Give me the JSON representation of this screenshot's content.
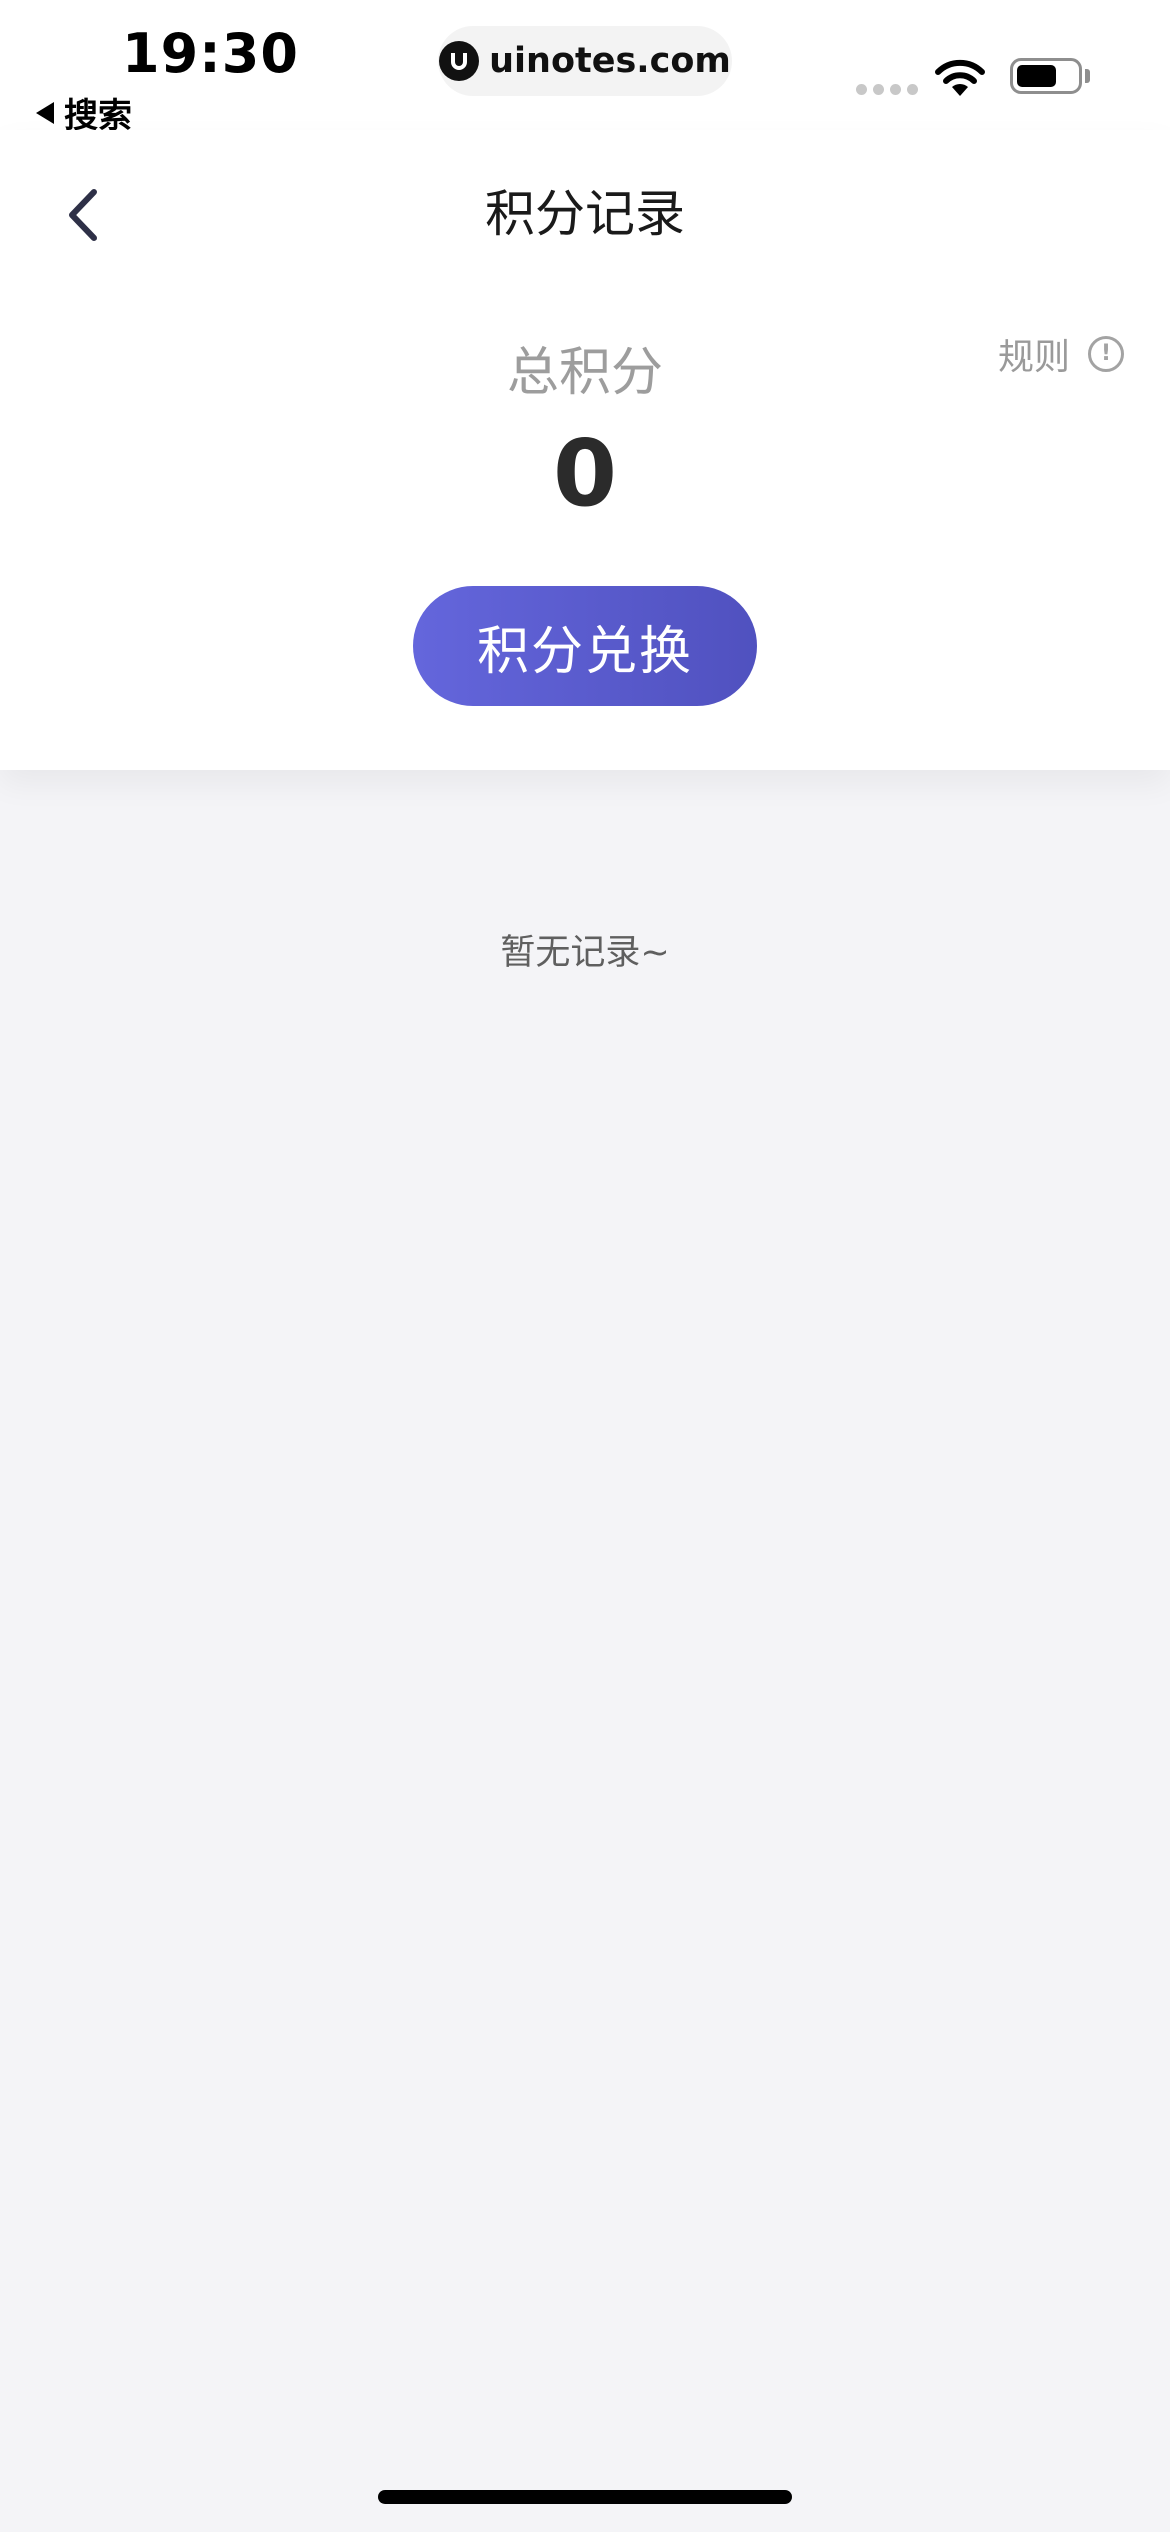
{
  "status_bar": {
    "time": "19:30",
    "back_label": "搜索",
    "url": "uinotes.com",
    "battery_level": 0.68
  },
  "header": {
    "title": "积分记录",
    "rules_label": "规则",
    "info_glyph": "!",
    "total_label": "总积分",
    "total_value": "0",
    "exchange_label": "积分兑换"
  },
  "records": {
    "empty_text": "暂无记录~"
  },
  "icons": {
    "back": "chevron-left-icon",
    "info": "info-icon",
    "wifi": "wifi-icon",
    "battery": "battery-icon",
    "site": "uinotes-logo-icon"
  },
  "colors": {
    "accent_start": "#6466dc",
    "accent_end": "#5051bf",
    "background": "#f4f4f7"
  }
}
